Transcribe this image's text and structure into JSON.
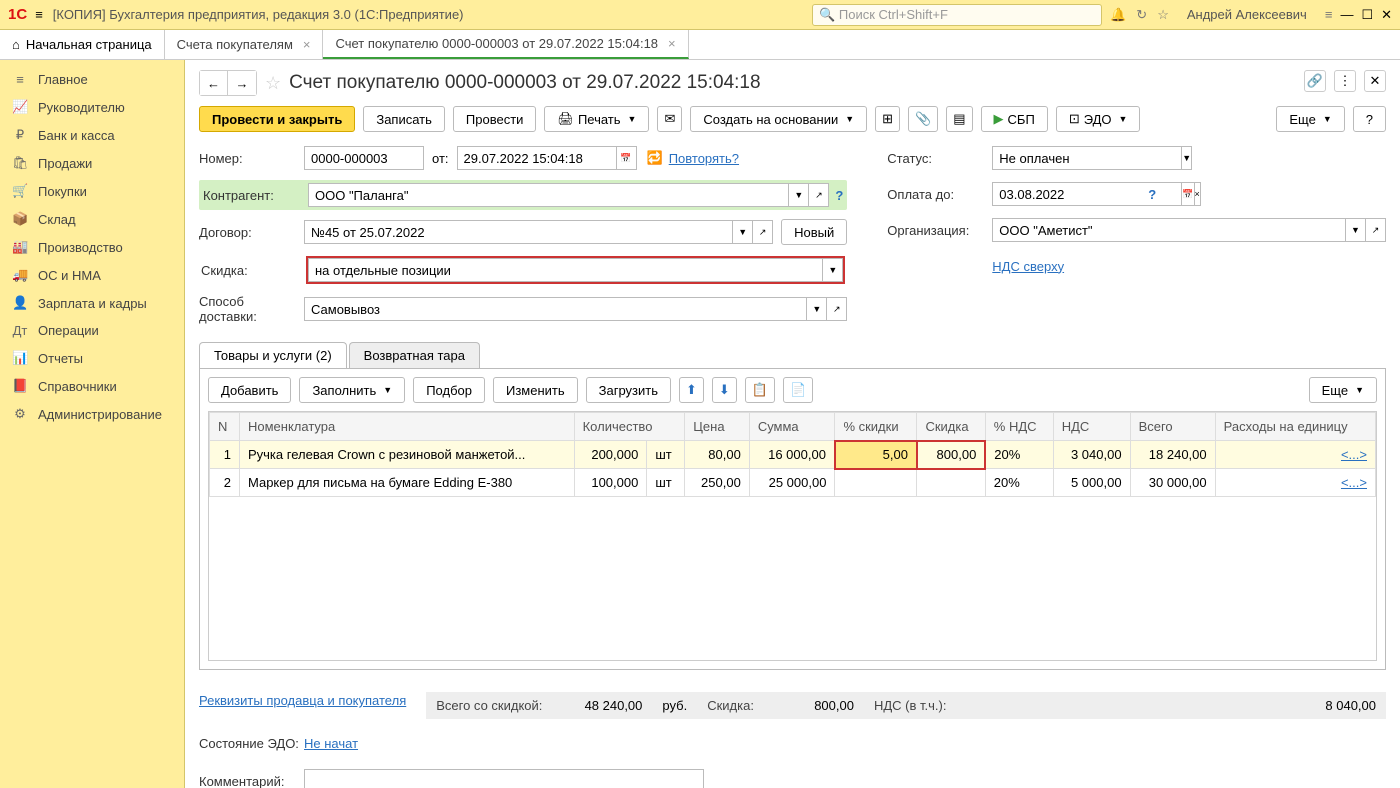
{
  "titlebar": {
    "logo": "1С",
    "title": "[КОПИЯ] Бухгалтерия предприятия, редакция 3.0  (1С:Предприятие)",
    "search_placeholder": "Поиск Ctrl+Shift+F",
    "user": "Андрей Алексеевич"
  },
  "tabs": {
    "home": "Начальная страница",
    "items": [
      {
        "label": "Счета покупателям",
        "active": false
      },
      {
        "label": "Счет покупателю 0000-000003 от 29.07.2022 15:04:18",
        "active": true
      }
    ]
  },
  "sidebar": [
    {
      "icon": "≡",
      "label": "Главное"
    },
    {
      "icon": "📈",
      "label": "Руководителю"
    },
    {
      "icon": "₽",
      "label": "Банк и касса"
    },
    {
      "icon": "🛍",
      "label": "Продажи"
    },
    {
      "icon": "🛒",
      "label": "Покупки"
    },
    {
      "icon": "📦",
      "label": "Склад"
    },
    {
      "icon": "🏭",
      "label": "Производство"
    },
    {
      "icon": "🚚",
      "label": "ОС и НМА"
    },
    {
      "icon": "👤",
      "label": "Зарплата и кадры"
    },
    {
      "icon": "Дт",
      "label": "Операции"
    },
    {
      "icon": "📊",
      "label": "Отчеты"
    },
    {
      "icon": "📕",
      "label": "Справочники"
    },
    {
      "icon": "⚙",
      "label": "Администрирование"
    }
  ],
  "page": {
    "title": "Счет покупателю 0000-000003 от 29.07.2022 15:04:18"
  },
  "toolbar": {
    "post_close": "Провести и закрыть",
    "save": "Записать",
    "post": "Провести",
    "print": "Печать",
    "create_based": "Создать на основании",
    "sbp": "СБП",
    "edo": "ЭДО",
    "more": "Еще",
    "help": "?"
  },
  "form": {
    "number_label": "Номер:",
    "number": "0000-000003",
    "from_label": "от:",
    "date": "29.07.2022 15:04:18",
    "repeat": "Повторять?",
    "counterparty_label": "Контрагент:",
    "counterparty": "ООО \"Паланга\"",
    "contract_label": "Договор:",
    "contract": "№45 от 25.07.2022",
    "new_btn": "Новый",
    "discount_label": "Скидка:",
    "discount": "на отдельные позиции",
    "delivery_label": "Способ доставки:",
    "delivery": "Самовывоз",
    "status_label": "Статус:",
    "status": "Не оплачен",
    "payuntil_label": "Оплата до:",
    "payuntil": "03.08.2022",
    "org_label": "Организация:",
    "org": "ООО \"Аметист\"",
    "vat_link": "НДС сверху"
  },
  "doc_tabs": {
    "goods": "Товары и услуги (2)",
    "tare": "Возвратная тара"
  },
  "table_toolbar": {
    "add": "Добавить",
    "fill": "Заполнить",
    "pick": "Подбор",
    "edit": "Изменить",
    "load": "Загрузить",
    "more": "Еще"
  },
  "table": {
    "headers": [
      "N",
      "Номенклатура",
      "Количество",
      "",
      "Цена",
      "Сумма",
      "% скидки",
      "Скидка",
      "% НДС",
      "НДС",
      "Всего",
      "Расходы на единицу"
    ],
    "rows": [
      {
        "n": "1",
        "name": "Ручка гелевая Crown с резиновой манжетой...",
        "qty": "200,000",
        "unit": "шт",
        "price": "80,00",
        "sum": "16 000,00",
        "disc_pct": "5,00",
        "disc": "800,00",
        "vat_pct": "20%",
        "vat": "3 040,00",
        "total": "18 240,00",
        "expense": "<...>"
      },
      {
        "n": "2",
        "name": "Маркер для письма на бумаге Edding E-380",
        "qty": "100,000",
        "unit": "шт",
        "price": "250,00",
        "sum": "25 000,00",
        "disc_pct": "",
        "disc": "",
        "vat_pct": "20%",
        "vat": "5 000,00",
        "total": "30 000,00",
        "expense": "<...>"
      }
    ]
  },
  "footer": {
    "seller_link": "Реквизиты продавца и покупателя",
    "total_label": "Всего со скидкой:",
    "total": "48 240,00",
    "currency": "руб.",
    "discount_label": "Скидка:",
    "discount": "800,00",
    "vat_label": "НДС (в т.ч.):",
    "vat": "8 040,00",
    "edo_state_label": "Состояние ЭДО:",
    "edo_state": "Не начат",
    "comment_label": "Комментарий:"
  }
}
